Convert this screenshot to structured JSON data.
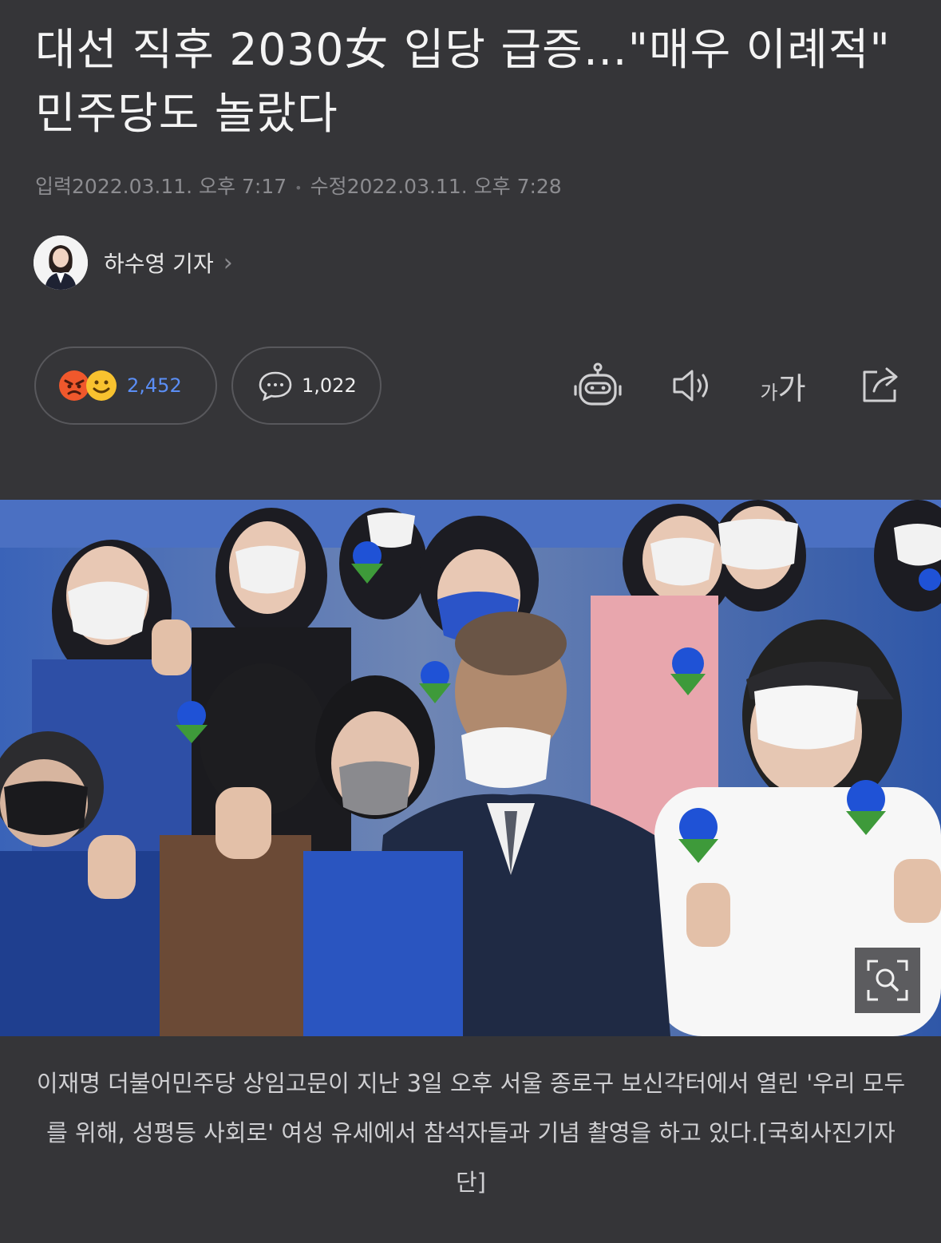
{
  "article": {
    "headline": "대선 직후 2030女 입당 급증…\"매우 이례적\" 민주당도 놀랐다",
    "input_label": "입력",
    "input_time": "2022.03.11. 오후 7:17",
    "edit_label": "수정",
    "edit_time": "2022.03.11. 오후 7:28"
  },
  "reporter": {
    "name": "하수영 기자"
  },
  "reactions": {
    "count": "2,452",
    "icons": [
      "angry-face-icon",
      "smile-face-icon"
    ]
  },
  "comments": {
    "count": "1,022"
  },
  "toolbar": {
    "icons": [
      "robot-summary-icon",
      "speaker-icon",
      "font-size-icon",
      "share-icon"
    ],
    "font_small": "가",
    "font_big": "가"
  },
  "photo": {
    "caption": "이재명 더불어민주당 상임고문이 지난 3일 오후 서울 종로구 보신각터에서 열린 '우리 모두를 위해, 성평등 사회로' 여성 유세에서 참석자들과 기념 촬영을 하고 있다.[국회사진기자단]"
  },
  "colors": {
    "background": "#353538",
    "accent_blue": "#5b8ef5",
    "meta_gray": "#8c8c90"
  }
}
